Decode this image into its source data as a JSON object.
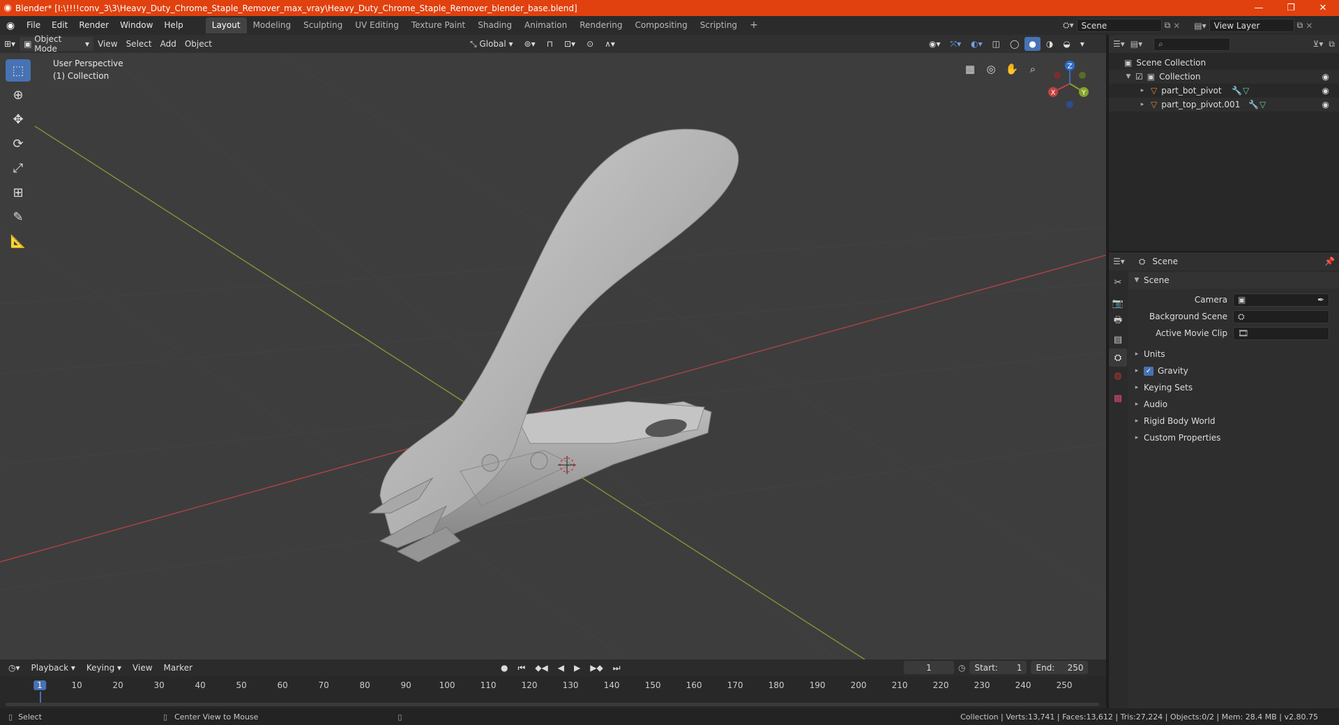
{
  "title_bar": {
    "title": "Blender* [I:\\!!!!conv_3\\3\\Heavy_Duty_Chrome_Staple_Remover_max_vray\\Heavy_Duty_Chrome_Staple_Remover_blender_base.blend]"
  },
  "menu": [
    "File",
    "Edit",
    "Render",
    "Window",
    "Help"
  ],
  "workspaces": [
    "Layout",
    "Modeling",
    "Sculpting",
    "UV Editing",
    "Texture Paint",
    "Shading",
    "Animation",
    "Rendering",
    "Compositing",
    "Scripting"
  ],
  "active_workspace": "Layout",
  "scene_field": "Scene",
  "view_layer_field": "View Layer",
  "viewport_header": {
    "mode": "Object Mode",
    "menus": [
      "View",
      "Select",
      "Add",
      "Object"
    ],
    "orientation": "Global"
  },
  "viewport": {
    "perspective_label": "User Perspective",
    "collection_label": "(1) Collection",
    "gizmo_axes": [
      "Z",
      "Y",
      "X"
    ]
  },
  "outliner": {
    "root": "Scene Collection",
    "collection": "Collection",
    "objects": [
      "part_bot_pivot",
      "part_top_pivot.001"
    ]
  },
  "properties": {
    "context": "Scene",
    "panel_title": "Scene",
    "fields": [
      {
        "label": "Camera",
        "value": ""
      },
      {
        "label": "Background Scene",
        "value": ""
      },
      {
        "label": "Active Movie Clip",
        "value": ""
      }
    ],
    "sections": [
      "Units",
      "Gravity",
      "Keying Sets",
      "Audio",
      "Rigid Body World",
      "Custom Properties"
    ],
    "gravity_checked": true
  },
  "timeline": {
    "menus": [
      "Playback",
      "Keying",
      "View",
      "Marker"
    ],
    "current_frame": "1",
    "start_label": "Start:",
    "start": "1",
    "end_label": "End:",
    "end": "250",
    "ticks": [
      "1",
      "10",
      "20",
      "30",
      "40",
      "50",
      "60",
      "70",
      "80",
      "90",
      "100",
      "110",
      "120",
      "130",
      "140",
      "150",
      "160",
      "170",
      "180",
      "190",
      "200",
      "210",
      "220",
      "230",
      "240",
      "250"
    ]
  },
  "status_bar": {
    "left_hint": "Select",
    "mid_hint": "Center View to Mouse",
    "stats": "Collection | Verts:13,741 | Faces:13,612 | Tris:27,224 | Objects:0/2 | Mem: 28.4 MB | v2.80.75"
  },
  "colors": {
    "title_bar": "#e0410f",
    "accent": "#4772b3",
    "x_axis": "#c3423f",
    "y_axis": "#86a32a",
    "z_axis": "#2f6fd0",
    "viewport_bg": "#3d3d3d"
  }
}
